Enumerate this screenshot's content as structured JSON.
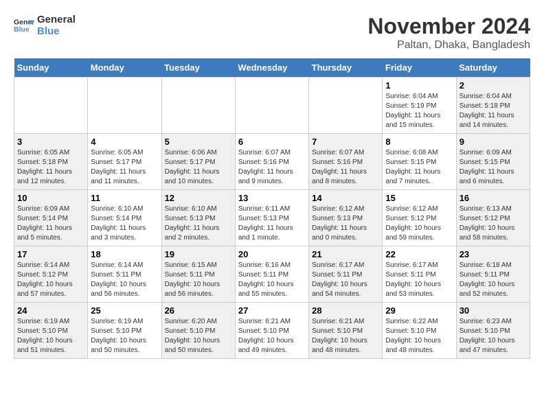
{
  "header": {
    "logo_line1": "General",
    "logo_line2": "Blue",
    "title": "November 2024",
    "subtitle": "Paltan, Dhaka, Bangladesh"
  },
  "weekdays": [
    "Sunday",
    "Monday",
    "Tuesday",
    "Wednesday",
    "Thursday",
    "Friday",
    "Saturday"
  ],
  "weeks": [
    [
      {
        "day": "",
        "info": ""
      },
      {
        "day": "",
        "info": ""
      },
      {
        "day": "",
        "info": ""
      },
      {
        "day": "",
        "info": ""
      },
      {
        "day": "",
        "info": ""
      },
      {
        "day": "1",
        "info": "Sunrise: 6:04 AM\nSunset: 5:19 PM\nDaylight: 11 hours and 15 minutes."
      },
      {
        "day": "2",
        "info": "Sunrise: 6:04 AM\nSunset: 5:18 PM\nDaylight: 11 hours and 14 minutes."
      }
    ],
    [
      {
        "day": "3",
        "info": "Sunrise: 6:05 AM\nSunset: 5:18 PM\nDaylight: 11 hours and 12 minutes."
      },
      {
        "day": "4",
        "info": "Sunrise: 6:05 AM\nSunset: 5:17 PM\nDaylight: 11 hours and 11 minutes."
      },
      {
        "day": "5",
        "info": "Sunrise: 6:06 AM\nSunset: 5:17 PM\nDaylight: 11 hours and 10 minutes."
      },
      {
        "day": "6",
        "info": "Sunrise: 6:07 AM\nSunset: 5:16 PM\nDaylight: 11 hours and 9 minutes."
      },
      {
        "day": "7",
        "info": "Sunrise: 6:07 AM\nSunset: 5:16 PM\nDaylight: 11 hours and 8 minutes."
      },
      {
        "day": "8",
        "info": "Sunrise: 6:08 AM\nSunset: 5:15 PM\nDaylight: 11 hours and 7 minutes."
      },
      {
        "day": "9",
        "info": "Sunrise: 6:09 AM\nSunset: 5:15 PM\nDaylight: 11 hours and 6 minutes."
      }
    ],
    [
      {
        "day": "10",
        "info": "Sunrise: 6:09 AM\nSunset: 5:14 PM\nDaylight: 11 hours and 5 minutes."
      },
      {
        "day": "11",
        "info": "Sunrise: 6:10 AM\nSunset: 5:14 PM\nDaylight: 11 hours and 3 minutes."
      },
      {
        "day": "12",
        "info": "Sunrise: 6:10 AM\nSunset: 5:13 PM\nDaylight: 11 hours and 2 minutes."
      },
      {
        "day": "13",
        "info": "Sunrise: 6:11 AM\nSunset: 5:13 PM\nDaylight: 11 hours and 1 minute."
      },
      {
        "day": "14",
        "info": "Sunrise: 6:12 AM\nSunset: 5:13 PM\nDaylight: 11 hours and 0 minutes."
      },
      {
        "day": "15",
        "info": "Sunrise: 6:12 AM\nSunset: 5:12 PM\nDaylight: 10 hours and 59 minutes."
      },
      {
        "day": "16",
        "info": "Sunrise: 6:13 AM\nSunset: 5:12 PM\nDaylight: 10 hours and 58 minutes."
      }
    ],
    [
      {
        "day": "17",
        "info": "Sunrise: 6:14 AM\nSunset: 5:12 PM\nDaylight: 10 hours and 57 minutes."
      },
      {
        "day": "18",
        "info": "Sunrise: 6:14 AM\nSunset: 5:11 PM\nDaylight: 10 hours and 56 minutes."
      },
      {
        "day": "19",
        "info": "Sunrise: 6:15 AM\nSunset: 5:11 PM\nDaylight: 10 hours and 56 minutes."
      },
      {
        "day": "20",
        "info": "Sunrise: 6:16 AM\nSunset: 5:11 PM\nDaylight: 10 hours and 55 minutes."
      },
      {
        "day": "21",
        "info": "Sunrise: 6:17 AM\nSunset: 5:11 PM\nDaylight: 10 hours and 54 minutes."
      },
      {
        "day": "22",
        "info": "Sunrise: 6:17 AM\nSunset: 5:11 PM\nDaylight: 10 hours and 53 minutes."
      },
      {
        "day": "23",
        "info": "Sunrise: 6:18 AM\nSunset: 5:11 PM\nDaylight: 10 hours and 52 minutes."
      }
    ],
    [
      {
        "day": "24",
        "info": "Sunrise: 6:19 AM\nSunset: 5:10 PM\nDaylight: 10 hours and 51 minutes."
      },
      {
        "day": "25",
        "info": "Sunrise: 6:19 AM\nSunset: 5:10 PM\nDaylight: 10 hours and 50 minutes."
      },
      {
        "day": "26",
        "info": "Sunrise: 6:20 AM\nSunset: 5:10 PM\nDaylight: 10 hours and 50 minutes."
      },
      {
        "day": "27",
        "info": "Sunrise: 6:21 AM\nSunset: 5:10 PM\nDaylight: 10 hours and 49 minutes."
      },
      {
        "day": "28",
        "info": "Sunrise: 6:21 AM\nSunset: 5:10 PM\nDaylight: 10 hours and 48 minutes."
      },
      {
        "day": "29",
        "info": "Sunrise: 6:22 AM\nSunset: 5:10 PM\nDaylight: 10 hours and 48 minutes."
      },
      {
        "day": "30",
        "info": "Sunrise: 6:23 AM\nSunset: 5:10 PM\nDaylight: 10 hours and 47 minutes."
      }
    ]
  ]
}
